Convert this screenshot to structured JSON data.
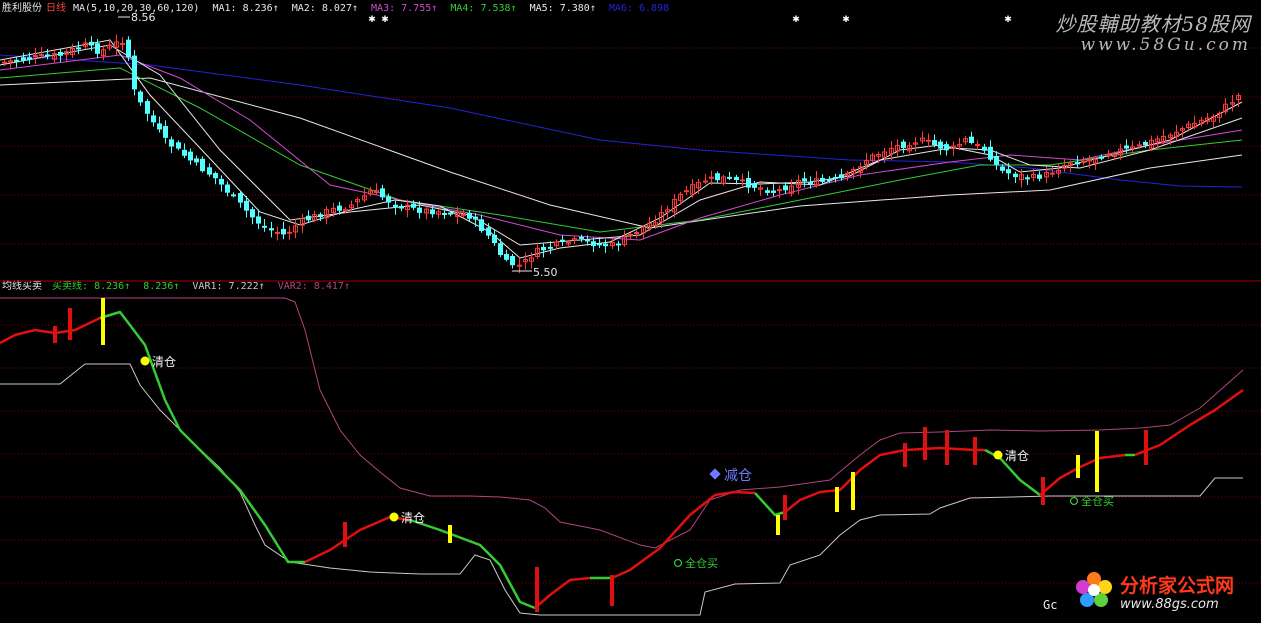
{
  "header_top": {
    "stock": "胜利股份",
    "period": "日线",
    "ma_params": "MA(5,10,20,30,60,120)",
    "items": [
      {
        "label": "MA1:",
        "value": "8.236↑",
        "color": "#e8e8e8"
      },
      {
        "label": "MA2:",
        "value": "8.027↑",
        "color": "#e8e8e8"
      },
      {
        "label": "MA3:",
        "value": "7.755↑",
        "color": "#d24bd2"
      },
      {
        "label": "MA4:",
        "value": "7.538↑",
        "color": "#33cc33"
      },
      {
        "label": "MA5:",
        "value": "7.380↑",
        "color": "#e8e8e8"
      },
      {
        "label": "MA6:",
        "value": "6.898",
        "color": "#2323d8"
      }
    ]
  },
  "header_bottom": {
    "indicator": "均线买卖",
    "items": [
      {
        "label": "买卖线:",
        "value": "8.236↑",
        "color": "#33cc33"
      },
      {
        "label": "",
        "value": "8.236↑",
        "color": "#33cc33"
      },
      {
        "label": "VAR1:",
        "value": "7.222↑",
        "color": "#c8c8c8"
      },
      {
        "label": "VAR2:",
        "value": "8.417↑",
        "color": "#b04480"
      }
    ]
  },
  "watermarks": {
    "top_cn": "炒股輔助教材58股网",
    "top_url": "www.58Gu.com",
    "bottom_cn": "分析家公式网",
    "bottom_url": "www.88gs.com",
    "bottom_left": "Gc"
  },
  "chart_data": [
    {
      "type": "candlestick",
      "title": "胜利股份 日线",
      "annotations": [
        {
          "text": "8.56",
          "kind": "high-marker"
        },
        {
          "text": "5.50",
          "kind": "low-marker"
        }
      ],
      "series": [
        {
          "name": "MA1",
          "color": "#e8e8e8",
          "period": 5
        },
        {
          "name": "MA2",
          "color": "#e8e8e8",
          "period": 10
        },
        {
          "name": "MA3",
          "color": "#d24bd2",
          "period": 20
        },
        {
          "name": "MA4",
          "color": "#33cc33",
          "period": 30
        },
        {
          "name": "MA5",
          "color": "#e8e8e8",
          "period": 60
        },
        {
          "name": "MA6",
          "color": "#2323d8",
          "period": 120
        }
      ]
    },
    {
      "type": "line",
      "title": "均线买卖",
      "series": [
        {
          "name": "买卖线",
          "color_up": "#e01010",
          "color_down": "#33cc33"
        },
        {
          "name": "VAR1",
          "color": "#c8c8c8"
        },
        {
          "name": "VAR2",
          "color": "#b04480"
        }
      ],
      "annotations": [
        {
          "text": "清仓",
          "color": "#f5f5f5",
          "dot": "#ffff00"
        },
        {
          "text": "清仓",
          "color": "#f5f5f5",
          "dot": "#ffff00"
        },
        {
          "text": "清仓",
          "color": "#f5f5f5",
          "dot": "#ffff00"
        },
        {
          "text": "减仓",
          "color": "#6f7bff",
          "dot": "#6f7bff"
        },
        {
          "text": "全仓买",
          "color": "#33cc33",
          "dot": "#33cc33"
        },
        {
          "text": "全仓买",
          "color": "#33cc33",
          "dot": "#33cc33"
        }
      ]
    }
  ],
  "colors": {
    "background": "#000000",
    "grid": "#800000",
    "up_candle": "#ff3a3a",
    "down_candle": "#54ffff",
    "separator": "#a00000"
  }
}
